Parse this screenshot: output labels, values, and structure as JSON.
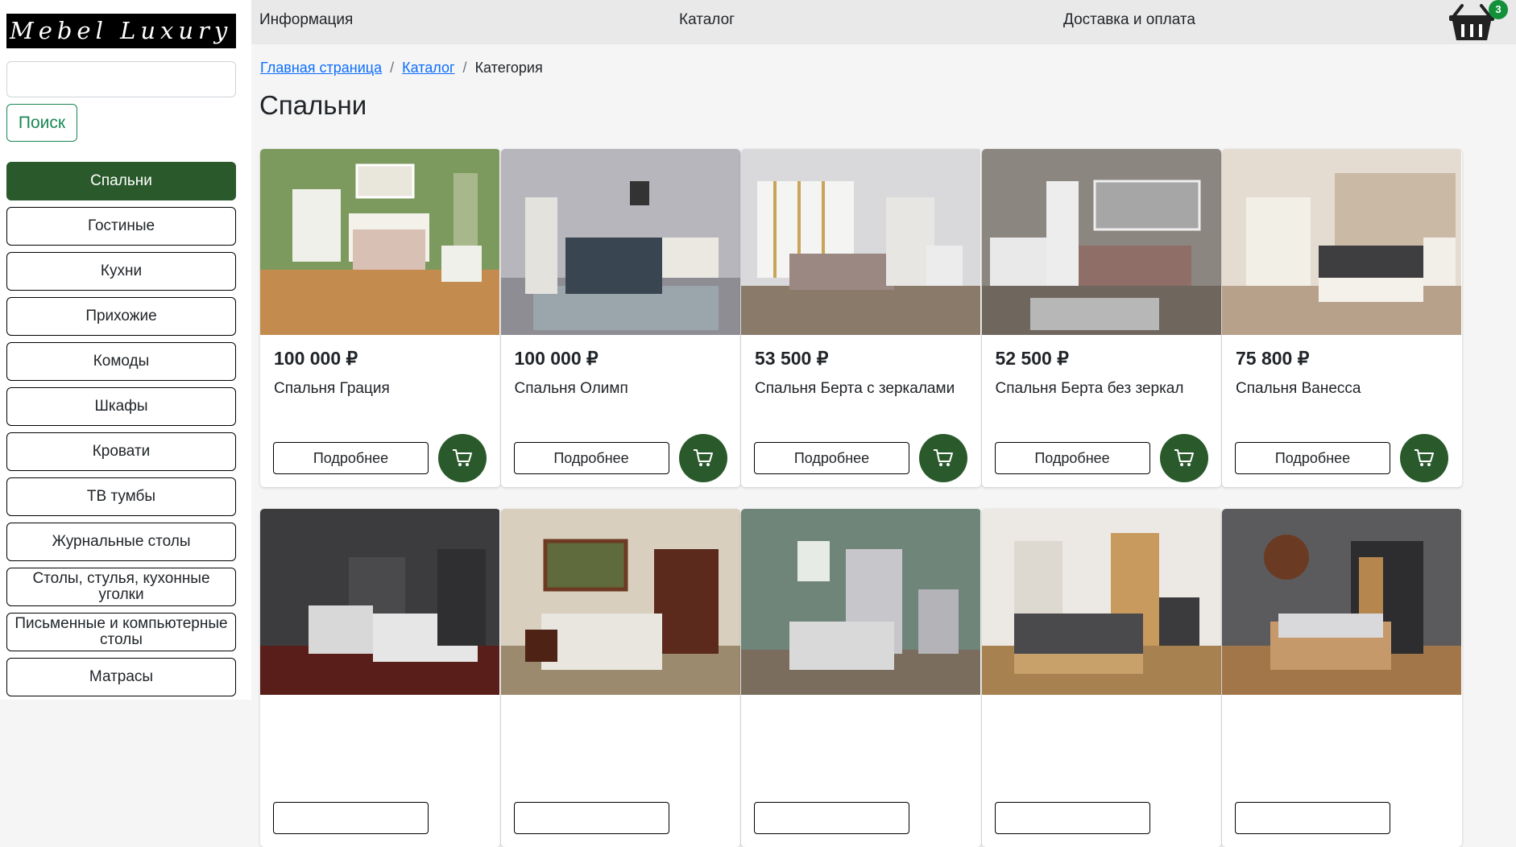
{
  "brand": {
    "logo_text": "Mebel Luxury"
  },
  "search": {
    "placeholder": "",
    "value": "",
    "button_label": "Поиск"
  },
  "categories": [
    {
      "label": "Спальни",
      "active": true
    },
    {
      "label": "Гостиные"
    },
    {
      "label": "Кухни"
    },
    {
      "label": "Прихожие"
    },
    {
      "label": "Комоды"
    },
    {
      "label": "Шкафы"
    },
    {
      "label": "Кровати"
    },
    {
      "label": "ТВ тумбы"
    },
    {
      "label": "Журнальные столы"
    },
    {
      "label": "Столы, стулья, кухонные уголки"
    },
    {
      "label": "Письменные и компьютерные столы"
    },
    {
      "label": "Матрасы"
    }
  ],
  "nav": {
    "info": "Информация",
    "catalog": "Каталог",
    "delivery": "Доставка и оплата"
  },
  "cart": {
    "count": "3",
    "icon": "basket-icon"
  },
  "breadcrumb": {
    "home": "Главная страница",
    "catalog": "Каталог",
    "current": "Категория",
    "separator": "/"
  },
  "page": {
    "title": "Спальни"
  },
  "products": [
    {
      "price": "100 000 ₽",
      "name": "Спальня Грация",
      "more_label": "Подробнее"
    },
    {
      "price": "100 000 ₽",
      "name": "Спальня Олимп",
      "more_label": "Подробнее"
    },
    {
      "price": "53 500 ₽",
      "name": "Спальня Берта с зеркалами",
      "more_label": "Подробнее"
    },
    {
      "price": "52 500 ₽",
      "name": "Спальня Берта без зеркал",
      "more_label": "Подробнее"
    },
    {
      "price": "75 800 ₽",
      "name": "Спальня Ванесса",
      "more_label": "Подробнее"
    },
    {
      "price": "",
      "name": "",
      "more_label": ""
    },
    {
      "price": "",
      "name": "",
      "more_label": ""
    },
    {
      "price": "",
      "name": "",
      "more_label": ""
    },
    {
      "price": "",
      "name": "",
      "more_label": ""
    },
    {
      "price": "",
      "name": "",
      "more_label": ""
    }
  ],
  "colors": {
    "accent": "#2a5a2b",
    "badge": "#12913a",
    "link": "#0d6efd",
    "search_outline": "#198754"
  }
}
